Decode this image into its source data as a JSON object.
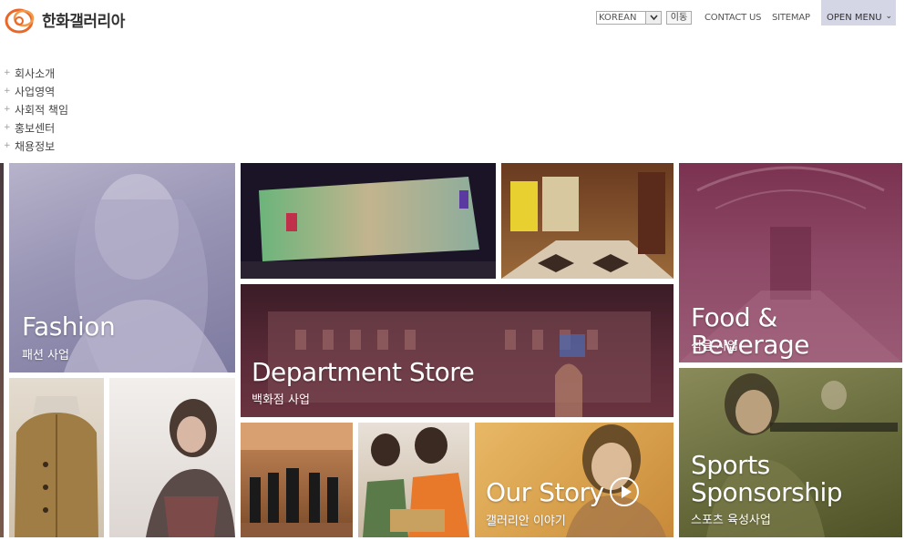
{
  "header": {
    "logo_text": "한화갤러리아",
    "language": "KOREAN",
    "go_label": "이동",
    "contact_label": "CONTACT US",
    "sitemap_label": "SITEMAP",
    "open_menu_label": "OPEN MENU"
  },
  "nav": {
    "items": [
      {
        "label": "회사소개"
      },
      {
        "label": "사업영역"
      },
      {
        "label": "사회적 책임"
      },
      {
        "label": "홍보센터"
      },
      {
        "label": "채용정보"
      }
    ]
  },
  "tiles": {
    "fashion": {
      "title": "Fashion",
      "subtitle": "패션 사업"
    },
    "department": {
      "title": "Department Store",
      "subtitle": "백화점 사업"
    },
    "food": {
      "title": "Food & Beverage",
      "subtitle": "식음 사업"
    },
    "story": {
      "title": "Our Story",
      "subtitle": "갤러리안 이야기"
    },
    "sports": {
      "title": "Sports Sponsorship",
      "subtitle": "스포츠 육성사업"
    }
  },
  "colors": {
    "brand_orange": "#e8682a",
    "open_menu_bg": "#d4d6e6",
    "fashion_overlay": "#8a86a8",
    "department_overlay": "#5a2a38",
    "food_overlay": "#8a3a5a",
    "story_overlay": "#d9a24e",
    "sports_overlay": "#5c6232"
  }
}
